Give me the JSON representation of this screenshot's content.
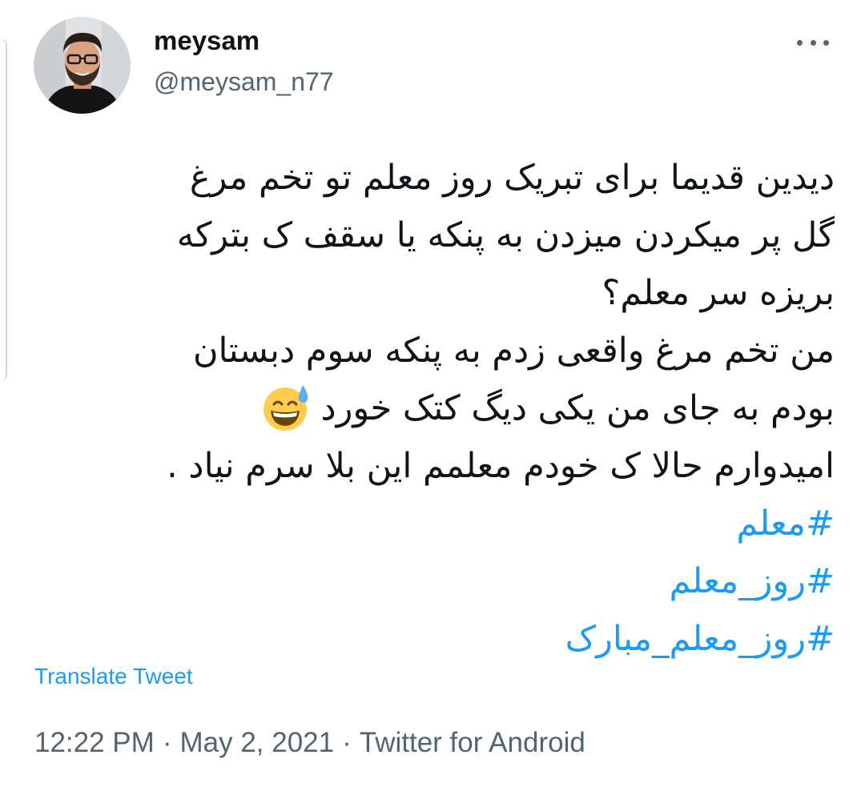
{
  "tweet": {
    "author": {
      "display_name": "meysam",
      "handle": "@meysam_n77",
      "avatar_icon": "profile-photo"
    },
    "more_icon": "more-options-icon",
    "lines": [
      "دیدین قدیما برای تبریک روز معلم تو تخم مرغ",
      "گل پر میکردن میزدن به پنکه یا سقف ک بترکه",
      "بریزه سر معلم؟",
      "من تخم مرغ واقعی زدم به پنکه سوم دبستان",
      "بودم به جای من یکی دیگ کتک خورد",
      "امیدوارم حالا ک خودم معلمم این بلا سرم نیاد ."
    ],
    "emoji": "grinning-face-with-sweat-emoji",
    "hashtags": [
      "#معلم",
      "#روز_معلم",
      "#روز_معلم_مبارک"
    ],
    "translate_label": "Translate Tweet",
    "time": "12:22 PM",
    "date": "May 2, 2021",
    "source": "Twitter for Android",
    "separator": "·"
  },
  "colors": {
    "link": "#1d9bf0",
    "secondary_text": "#536471",
    "primary_text": "#0f1419"
  }
}
